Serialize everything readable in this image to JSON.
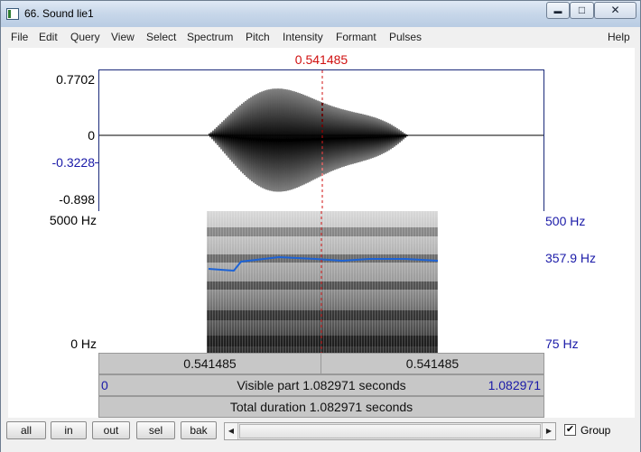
{
  "window": {
    "title": "66. Sound lie1",
    "controls": {
      "minimize": "▬",
      "maximize": "□",
      "close": "✕"
    }
  },
  "menu": {
    "items": [
      "File",
      "Edit",
      "Query",
      "View",
      "Select",
      "Spectrum",
      "Pitch",
      "Intensity",
      "Formant",
      "Pulses"
    ],
    "help": "Help"
  },
  "cursor": {
    "time_label": "0.541485",
    "color": "#d01010"
  },
  "waveform": {
    "ymax_label": "0.7702",
    "zero_label": "0",
    "cursor_value_label": "-0.3228",
    "ymin_label": "-0.898",
    "values": {
      "ymax": 0.7702,
      "ymin": -0.898,
      "cursor_value": -0.3228
    }
  },
  "spectrogram": {
    "top_label": "5000 Hz",
    "bottom_label": "0 Hz",
    "pitch_top_label": "500 Hz",
    "pitch_value_label": "357.9 Hz",
    "pitch_bottom_label": "75 Hz",
    "pitch_color": "#1d63d6"
  },
  "time_bars": {
    "left_segment": "0.541485",
    "right_segment": "0.541485",
    "visible_start": "0",
    "visible_text": "Visible part 1.082971 seconds",
    "visible_end": "1.082971",
    "total_text": "Total duration 1.082971 seconds"
  },
  "bottom": {
    "buttons": [
      "all",
      "in",
      "out",
      "sel",
      "bak"
    ],
    "scroll_left": "◀",
    "scroll_right": "▶",
    "group_checked": true,
    "group_check_mark": "✔",
    "group_label": "Group"
  }
}
